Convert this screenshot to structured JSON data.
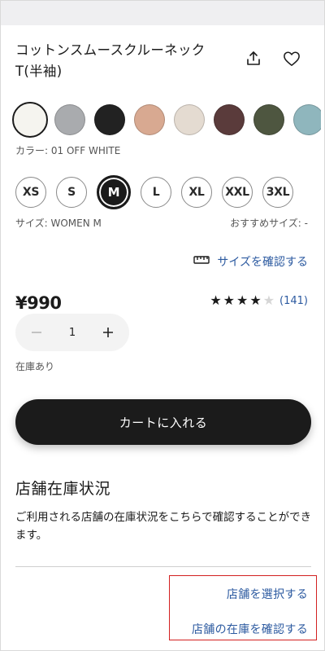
{
  "product": {
    "title": "コットンスムースクルーネックT(半袖)",
    "share_icon": "share-icon",
    "favorite_icon": "heart-icon"
  },
  "colors": {
    "swatches": [
      {
        "hex": "#f5f4ef",
        "selected": true
      },
      {
        "hex": "#a9abae",
        "selected": false
      },
      {
        "hex": "#222222",
        "selected": false
      },
      {
        "hex": "#d8a991",
        "selected": false
      },
      {
        "hex": "#e4dbd1",
        "selected": false
      },
      {
        "hex": "#5a3b3b",
        "selected": false
      },
      {
        "hex": "#4e5640",
        "selected": false
      },
      {
        "hex": "#8fb6bd",
        "selected": false
      }
    ],
    "label": "カラー: 01 OFF WHITE"
  },
  "sizes": {
    "options": [
      "XS",
      "S",
      "M",
      "L",
      "XL",
      "XXL",
      "3XL"
    ],
    "selected": "M",
    "label": "サイズ: WOMEN M",
    "recommended": "おすすめサイズ: -",
    "check_link": "サイズを確認する",
    "check_icon": "ruler-icon"
  },
  "price": "¥990",
  "rating": {
    "stars": 4,
    "max": 5,
    "count_text": "(141)"
  },
  "quantity": {
    "value": "1",
    "minus_icon": "minus-icon",
    "plus_icon": "plus-icon"
  },
  "stock_status": "在庫あり",
  "add_to_cart": "カートに入れる",
  "store_stock": {
    "heading": "店舗在庫状況",
    "description": "ご利用される店舗の在庫状況をこちらで確認することができます。",
    "select_store": "店舗を選択する",
    "check_stock": "店舗の在庫を確認する"
  },
  "colors_theme": {
    "link": "#2c5aa0",
    "highlight_box": "#d32020",
    "primary_button": "#1b1b1b"
  }
}
